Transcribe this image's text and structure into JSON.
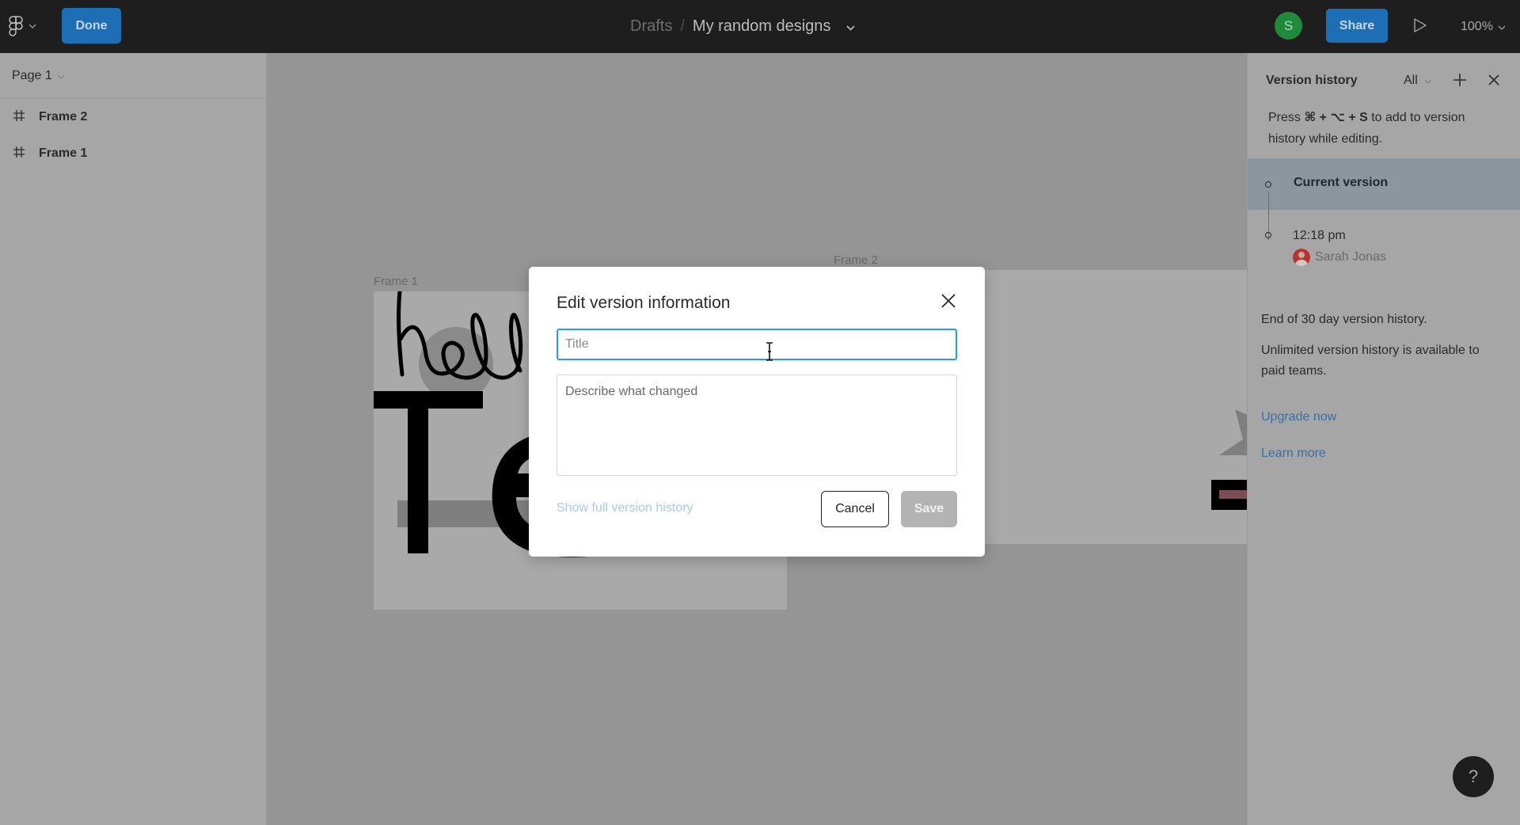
{
  "topbar": {
    "menu_icon": "figma-logo-icon",
    "done_label": "Done",
    "breadcrumb": {
      "parent": "Drafts",
      "separator": "/",
      "file": "My random designs"
    },
    "avatar_initial": "S",
    "share_label": "Share",
    "present_icon": "play-icon",
    "zoom_level": "100%"
  },
  "left_panel": {
    "page_selector": "Page 1",
    "layers": [
      {
        "icon": "frame-hash-icon",
        "label": "Frame 2"
      },
      {
        "icon": "frame-hash-icon",
        "label": "Frame 1"
      }
    ]
  },
  "canvas": {
    "frames": [
      {
        "label": "Frame 1",
        "handwriting": "hell",
        "big_text": "Te"
      },
      {
        "label": "Frame 2"
      }
    ],
    "colors": {
      "canvas_bg": "#959595",
      "frame_bg": "#a9a9a9",
      "shape_gray": "#7f7f7f",
      "stroke_black": "#000000",
      "pink_bar": "#7e4c55"
    }
  },
  "right_panel": {
    "title": "Version history",
    "filter": "All",
    "hint_prefix": "Press",
    "hint_keys": "⌘ + ⌥ + S",
    "hint_suffix": "to add to version history while editing.",
    "current_version": "Current version",
    "versions": [
      {
        "time": "12:18 pm",
        "author": "Sarah Jonas"
      }
    ],
    "end_notice": "End of 30 day version history.",
    "upgrade_notice": "Unlimited version history is available to paid teams.",
    "upgrade_link": "Upgrade now",
    "learn_link": "Learn more"
  },
  "dialog": {
    "title": "Edit version information",
    "title_placeholder": "Title",
    "title_value": "",
    "description_placeholder": "Describe what changed",
    "description_value": "",
    "history_link": "Show full version history",
    "cancel_label": "Cancel",
    "save_label": "Save"
  },
  "help": {
    "label": "?"
  },
  "colors": {
    "topbar_bg": "#1e1e1e",
    "accent_blue": "#1d6eb5",
    "focus_blue": "#2d9ae8",
    "avatar_green": "#1f8a3c",
    "author_avatar_red": "#b8352d",
    "current_row_bg": "#8b969e",
    "link_blue": "#3a6fa0"
  }
}
